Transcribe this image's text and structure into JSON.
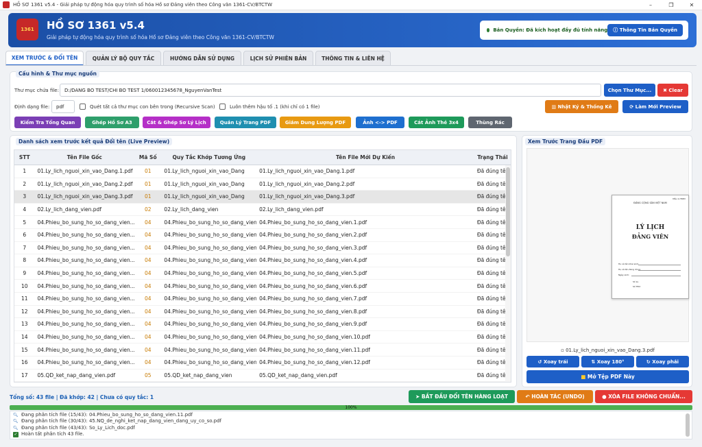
{
  "window": {
    "title": "HỒ SƠ 1361 v5.4 - Giải pháp tự động hóa quy trình số hóa Hồ sơ Đảng viên theo Công văn 1361-CV/BTCTW"
  },
  "header": {
    "logo_text": "1361",
    "title": "HỒ SƠ 1361 v5.4",
    "subtitle": "Giải pháp tự động hóa quy trình số hóa Hồ sơ Đảng viên theo Công văn 1361-CV/BTCTW",
    "license_text": "Bản Quyền: Đã kích hoạt đầy đủ tính năng",
    "license_button": "Thông Tin Bản Quyền"
  },
  "tabs": [
    "XEM TRƯỚC & ĐỔI TÊN",
    "QUẢN LÝ BỘ QUY TẮC",
    "HƯỚNG DẪN SỬ DỤNG",
    "LỊCH SỬ PHIÊN BẢN",
    "THÔNG TIN & LIÊN HỆ"
  ],
  "config": {
    "section_title": "Cấu hình & Thư mục nguồn",
    "folder_label": "Thư mục chứa file:",
    "folder_value": "D:/DANG BO TEST/CHI BO TEST 1/060012345678_NguyenVanTest",
    "choose_folder": "Chọn Thư Mục...",
    "clear": "Clear",
    "format_label": "Định dạng file:",
    "format_value": "pdf",
    "recursive_label": "Quét tất cả thư mục con bên trong (Recursive Scan)",
    "suffix_label": "Luôn thêm hậu tố .1 (khi chỉ có 1 file)",
    "log_button": "Nhật Ký & Thống Kê",
    "refresh_button": "Làm Mới Preview"
  },
  "tools": [
    {
      "label": "Kiểm Tra Tổng Quan",
      "color": "#7b3fb5"
    },
    {
      "label": "Ghép Hồ Sơ A3",
      "color": "#2e9f6b"
    },
    {
      "label": "Cắt & Ghép Sơ Lý Lịch",
      "color": "#b52fc7"
    },
    {
      "label": "Quản Lý Trang PDF",
      "color": "#1f8fb0"
    },
    {
      "label": "Giảm Dung Lượng PDF",
      "color": "#e89a12"
    },
    {
      "label": "Ảnh <-> PDF",
      "color": "#1e6fcf"
    },
    {
      "label": "Cắt Ảnh Thẻ 3x4",
      "color": "#1e9a5a"
    },
    {
      "label": "Thùng Rác",
      "color": "#5f6670"
    }
  ],
  "list": {
    "title": "Danh sách xem trước kết quả Đổi tên (Live Preview)",
    "columns": [
      "STT",
      "Tên File Gốc",
      "Mã Số",
      "Quy Tắc Khớp Tương Ứng",
      "Tên File Mới Dự Kiến",
      "Trạng Thái"
    ],
    "rows": [
      [
        "1",
        "01.Ly_lich_nguoi_xin_vao_Dang.1.pdf",
        "01",
        "01.Ly_lich_nguoi_xin_vao_Dang",
        "01.Ly_lich_nguoi_xin_vao_Dang.1.pdf",
        "Đã đúng tên"
      ],
      [
        "2",
        "01.Ly_lich_nguoi_xin_vao_Dang.2.pdf",
        "01",
        "01.Ly_lich_nguoi_xin_vao_Dang",
        "01.Ly_lich_nguoi_xin_vao_Dang.2.pdf",
        "Đã đúng tên"
      ],
      [
        "3",
        "01.Ly_lich_nguoi_xin_vao_Dang.3.pdf",
        "01",
        "01.Ly_lich_nguoi_xin_vao_Dang",
        "01.Ly_lich_nguoi_xin_vao_Dang.3.pdf",
        "Đã đúng tên"
      ],
      [
        "4",
        "02.Ly_lich_dang_vien.pdf",
        "02",
        "02.Ly_lich_dang_vien",
        "02.Ly_lich_dang_vien.pdf",
        "Đã đúng tên"
      ],
      [
        "5",
        "04.Phieu_bo_sung_ho_so_dang_vien....",
        "04",
        "04.Phieu_bo_sung_ho_so_dang_vien",
        "04.Phieu_bo_sung_ho_so_dang_vien.1.pdf",
        "Đã đúng tên"
      ],
      [
        "6",
        "04.Phieu_bo_sung_ho_so_dang_vien....",
        "04",
        "04.Phieu_bo_sung_ho_so_dang_vien",
        "04.Phieu_bo_sung_ho_so_dang_vien.2.pdf",
        "Đã đúng tên"
      ],
      [
        "7",
        "04.Phieu_bo_sung_ho_so_dang_vien....",
        "04",
        "04.Phieu_bo_sung_ho_so_dang_vien",
        "04.Phieu_bo_sung_ho_so_dang_vien.3.pdf",
        "Đã đúng tên"
      ],
      [
        "8",
        "04.Phieu_bo_sung_ho_so_dang_vien....",
        "04",
        "04.Phieu_bo_sung_ho_so_dang_vien",
        "04.Phieu_bo_sung_ho_so_dang_vien.4.pdf",
        "Đã đúng tên"
      ],
      [
        "9",
        "04.Phieu_bo_sung_ho_so_dang_vien....",
        "04",
        "04.Phieu_bo_sung_ho_so_dang_vien",
        "04.Phieu_bo_sung_ho_so_dang_vien.5.pdf",
        "Đã đúng tên"
      ],
      [
        "10",
        "04.Phieu_bo_sung_ho_so_dang_vien....",
        "04",
        "04.Phieu_bo_sung_ho_so_dang_vien",
        "04.Phieu_bo_sung_ho_so_dang_vien.6.pdf",
        "Đã đúng tên"
      ],
      [
        "11",
        "04.Phieu_bo_sung_ho_so_dang_vien....",
        "04",
        "04.Phieu_bo_sung_ho_so_dang_vien",
        "04.Phieu_bo_sung_ho_so_dang_vien.7.pdf",
        "Đã đúng tên"
      ],
      [
        "12",
        "04.Phieu_bo_sung_ho_so_dang_vien....",
        "04",
        "04.Phieu_bo_sung_ho_so_dang_vien",
        "04.Phieu_bo_sung_ho_so_dang_vien.8.pdf",
        "Đã đúng tên"
      ],
      [
        "13",
        "04.Phieu_bo_sung_ho_so_dang_vien....",
        "04",
        "04.Phieu_bo_sung_ho_so_dang_vien",
        "04.Phieu_bo_sung_ho_so_dang_vien.9.pdf",
        "Đã đúng tên"
      ],
      [
        "14",
        "04.Phieu_bo_sung_ho_so_dang_vien....",
        "04",
        "04.Phieu_bo_sung_ho_so_dang_vien",
        "04.Phieu_bo_sung_ho_so_dang_vien.10.pdf",
        "Đã đúng tên"
      ],
      [
        "15",
        "04.Phieu_bo_sung_ho_so_dang_vien....",
        "04",
        "04.Phieu_bo_sung_ho_so_dang_vien",
        "04.Phieu_bo_sung_ho_so_dang_vien.11.pdf",
        "Đã đúng tên"
      ],
      [
        "16",
        "04.Phieu_bo_sung_ho_so_dang_vien....",
        "04",
        "04.Phieu_bo_sung_ho_so_dang_vien",
        "04.Phieu_bo_sung_ho_so_dang_vien.12.pdf",
        "Đã đúng tên"
      ],
      [
        "17",
        "05.QD_ket_nap_dang_vien.pdf",
        "05",
        "05.QD_ket_nap_dang_vien",
        "05.QD_ket_nap_dang_vien.pdf",
        "Đã đúng tên"
      ]
    ],
    "selected_row": 2
  },
  "preview": {
    "title": "Xem Trước Trang Đầu PDF",
    "page_small_top": "Mẫu 1-HSĐV",
    "page_header": "ĐẢNG CỘNG SẢN VIỆT NAM",
    "page_title_1": "LÝ LỊCH",
    "page_title_2": "ĐẢNG VIÊN",
    "page_line_1": "Họ và tên khai sinh:",
    "page_line_2": "Họ và tên đang dùng:",
    "page_line_3": "Ngày sinh:",
    "page_line_4": "Số LL:",
    "page_line_5": "Số TĐV:",
    "file_name": "01.Ly_lich_nguoi_xin_vao_Dang.3.pdf",
    "rotate_left": "Xoay trái",
    "rotate_180": "Xoay 180°",
    "rotate_right": "Xoay phải",
    "open_pdf": "Mở Tệp PDF Này"
  },
  "footer": {
    "summary": "Tổng số: 43 file | Đã khớp: 42 | Chưa có quy tắc: 1",
    "start_button": "BẮT ĐẦU ĐỔI TÊN HÀNG LOẠT",
    "undo_button": "HOÀN TÁC (UNDO)",
    "delete_button": "XÓA FILE KHÔNG CHUẨN...",
    "progress_text": "100%",
    "progress_value": 1.0
  },
  "log": [
    "Đang phân tích file (15/43): 04.Phieu_bo_sung_ho_so_dang_vien.11.pdf",
    "Đang phân tích file (30/43): 45.NQ_de_nghi_ket_nap_dang_vien_dang_uy_co_so.pdf",
    "Đang phân tích file (43/43): So_Ly_Lich_doc.pdf",
    "Hoàn tất phân tích 43 file."
  ]
}
